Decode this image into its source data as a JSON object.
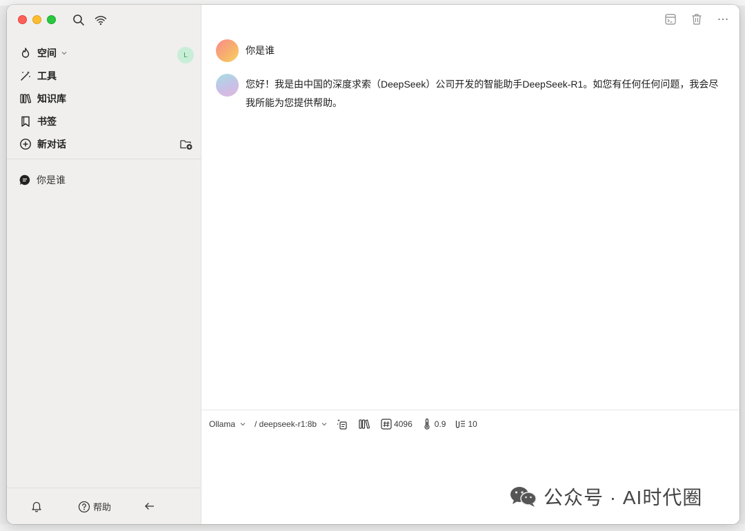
{
  "sidebar": {
    "user_initial": "L",
    "nav": [
      {
        "label": "空间",
        "icon": "flame-icon"
      },
      {
        "label": "工具",
        "icon": "magic-wand-icon"
      },
      {
        "label": "知识库",
        "icon": "books-icon"
      },
      {
        "label": "书签",
        "icon": "bookmark-icon"
      },
      {
        "label": "新对话",
        "icon": "plus-circle-icon"
      }
    ],
    "conversations": [
      {
        "label": "你是谁",
        "icon": "chat-bubble-icon"
      }
    ],
    "footer": {
      "help_label": "帮助"
    }
  },
  "chat": {
    "messages": [
      {
        "role": "user",
        "text": "你是谁"
      },
      {
        "role": "assistant",
        "text": "您好！我是由中国的深度求索（DeepSeek）公司开发的智能助手DeepSeek-R1。如您有任何任何问题，我会尽我所能为您提供帮助。"
      }
    ]
  },
  "composer": {
    "provider": "Ollama",
    "model": "/ deepseek-r1:8b",
    "max_tokens": "4096",
    "temperature": "0.9",
    "context_count": "10"
  },
  "watermark": {
    "text": "公众号 · AI时代圈"
  },
  "colors": {
    "sidebar_bg": "#f0efee",
    "avatar_bg": "#c9eed7"
  }
}
